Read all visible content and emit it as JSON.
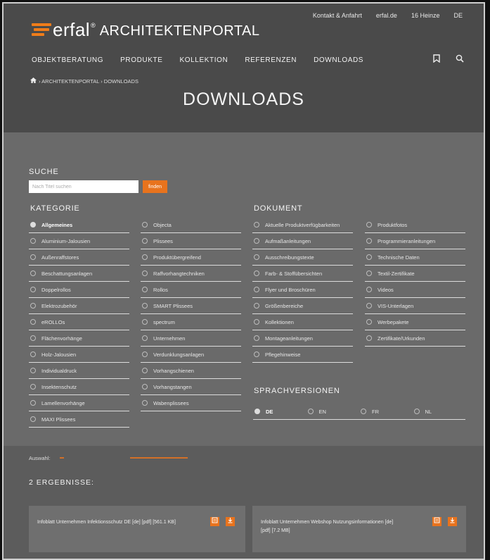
{
  "toplinks": [
    "Kontakt & Anfahrt",
    "erfal.de",
    "16 Heinze",
    "DE"
  ],
  "logo": {
    "brand": "erfal",
    "reg": "®",
    "portal": "ARCHITEKTENPORTAL"
  },
  "nav": [
    "OBJEKTBERATUNG",
    "PRODUKTE",
    "KOLLEKTION",
    "REFERENZEN",
    "DOWNLOADS"
  ],
  "nav_icons": [
    "bookmark-icon",
    "search-icon"
  ],
  "breadcrumb": {
    "home_icon": "home-icon",
    "text": "› ARCHITEKTENPORTAL › DOWNLOADS"
  },
  "page_title": "DOWNLOADS",
  "search": {
    "label": "SUCHE",
    "placeholder": "Nach Titel suchen",
    "button": "finden"
  },
  "kategorie": {
    "label": "KATEGORIE",
    "col1": [
      "Allgemeines",
      "Aluminium-Jalousien",
      "Außenraffstores",
      "Beschattungsanlagen",
      "Doppelrollos",
      "Elektrozubehör",
      "eROLLOs",
      "Flächenvorhänge",
      "Holz-Jalousien",
      "Individualdruck",
      "Insektenschutz",
      "Lamellenvorhänge",
      "MAXI Plissees"
    ],
    "col2": [
      "Objecta",
      "Plissees",
      "Produktübergreifend",
      "Raffvorhangtechniken",
      "Rollos",
      "SMART Plissees",
      "spectrum",
      "Unternehmen",
      "Verdunklungsanlagen",
      "Vorhangschienen",
      "Vorhangstangen",
      "Wabenplissees"
    ]
  },
  "dokument": {
    "label": "DOKUMENT",
    "col1": [
      "Aktuelle Produktverfügbarkeiten",
      "Aufmaßanleitungen",
      "Ausschreibungstexte",
      "Farb- & Stoffübersichten",
      "Flyer und Broschüren",
      "Größenbereiche",
      "Kollektionen",
      "Montageanleitungen",
      "Pflegehinweise"
    ],
    "col2": [
      "Produktfotos",
      "Programmieranleitungen",
      "Technische Daten",
      "Textil-Zertifikate",
      "Videos",
      "VIS-Unterlagen",
      "Werbepakete",
      "Zertifikate/Urkunden"
    ]
  },
  "sprachversionen": {
    "label": "SPRACHVERSIONEN",
    "options": [
      "DE",
      "EN",
      "FR",
      "NL"
    ]
  },
  "auswahl_label": "Auswahl:",
  "results_title": "2 ERGEBNISSE:",
  "results": [
    {
      "line1": "Infoblatt Unternehmen Infektionsschutz DE [de] [pdf] [561.1 KB]",
      "line2": ""
    },
    {
      "line1": "Infoblatt Unternehmen Webshop Nutzungsinformationen [de]",
      "line2": "[pdf] [7.2 MB]"
    }
  ],
  "colors": {
    "accent": "#e8731d",
    "header_bg": "#4a4a4a",
    "content_bg": "#6a6a6a"
  }
}
